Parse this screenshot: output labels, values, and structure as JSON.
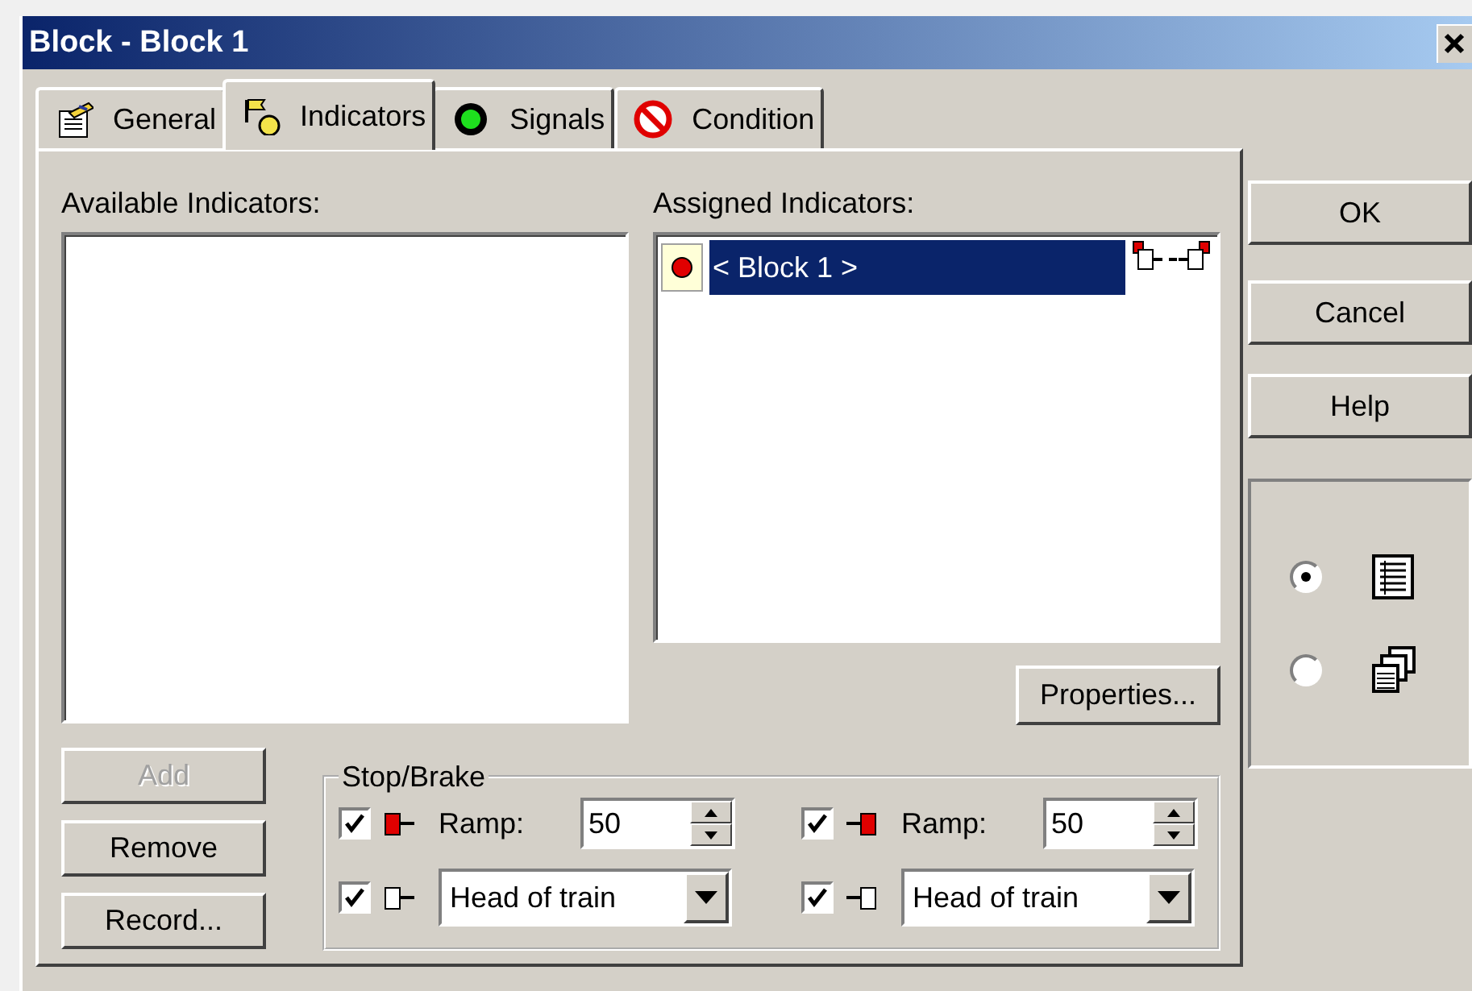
{
  "window": {
    "title": "Block - Block 1"
  },
  "tabs": [
    {
      "label": "General",
      "kind": "general",
      "selected": false
    },
    {
      "label": "Indicators",
      "kind": "indicators",
      "selected": true
    },
    {
      "label": "Signals",
      "kind": "signals",
      "selected": false
    },
    {
      "label": "Condition",
      "kind": "condition",
      "selected": false
    }
  ],
  "available_indicators": {
    "label": "Available Indicators:"
  },
  "assigned_indicators": {
    "label": "Assigned Indicators:",
    "items": [
      {
        "text": "< Block 1 >",
        "selected": true
      }
    ]
  },
  "properties_button": "Properties...",
  "list_buttons": [
    {
      "label": "Add",
      "disabled": true
    },
    {
      "label": "Remove",
      "disabled": false
    },
    {
      "label": "Record...",
      "disabled": false
    }
  ],
  "stop_brake": {
    "title": "Stop/Brake",
    "cells": [
      {
        "kind": "ramp",
        "checked": true,
        "facing_right": false,
        "filled": true,
        "label": "Ramp:",
        "value": "50"
      },
      {
        "kind": "ramp",
        "checked": true,
        "facing_right": true,
        "filled": true,
        "label": "Ramp:",
        "value": "50"
      },
      {
        "kind": "select",
        "checked": true,
        "facing_right": false,
        "filled": false,
        "value": "Head of train"
      },
      {
        "kind": "select",
        "checked": true,
        "facing_right": true,
        "filled": false,
        "value": "Head of train"
      }
    ]
  },
  "dialog_buttons": [
    "OK",
    "Cancel",
    "Help"
  ],
  "view_options": [
    {
      "kind": "list",
      "selected": true
    },
    {
      "kind": "windows",
      "selected": false
    }
  ]
}
